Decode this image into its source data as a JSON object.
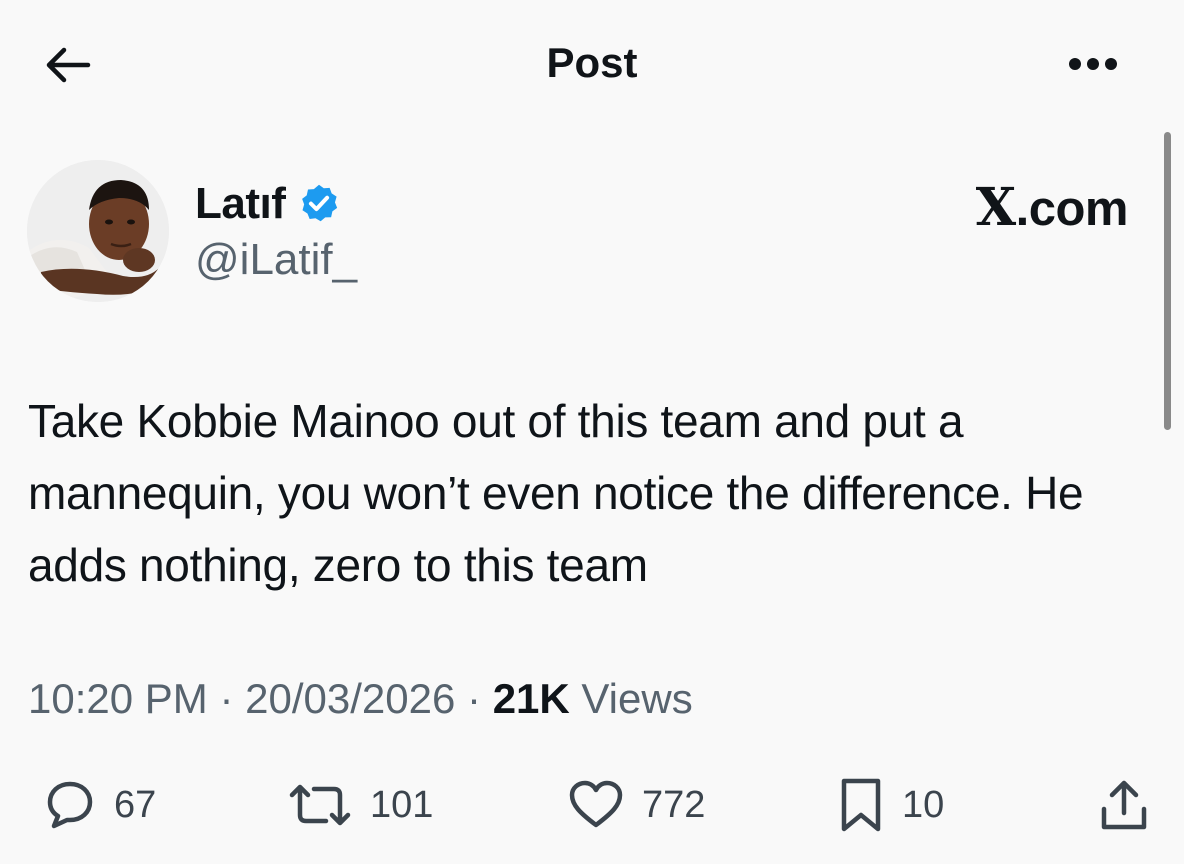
{
  "header": {
    "title": "Post"
  },
  "author": {
    "display_name": "Latıf",
    "handle": "@iLatif_",
    "verified": true,
    "avatar_icon": "profile-photo"
  },
  "source": {
    "label": ".com",
    "logo": "X"
  },
  "tweet": {
    "text": "Take Kobbie Mainoo out of this team and put a mannequin, you won’t even notice the difference. He adds nothing, zero to this team",
    "time": "10:20 PM",
    "date": "20/03/2026",
    "separator": "·",
    "views_count": "21K",
    "views_label": "Views"
  },
  "actions": {
    "replies": "67",
    "reposts": "101",
    "likes": "772",
    "bookmarks": "10"
  },
  "colors": {
    "verified_badge": "#1d9bf0",
    "text": "#0f1419",
    "secondary_text": "#57636e",
    "background": "#f9f9f9"
  }
}
